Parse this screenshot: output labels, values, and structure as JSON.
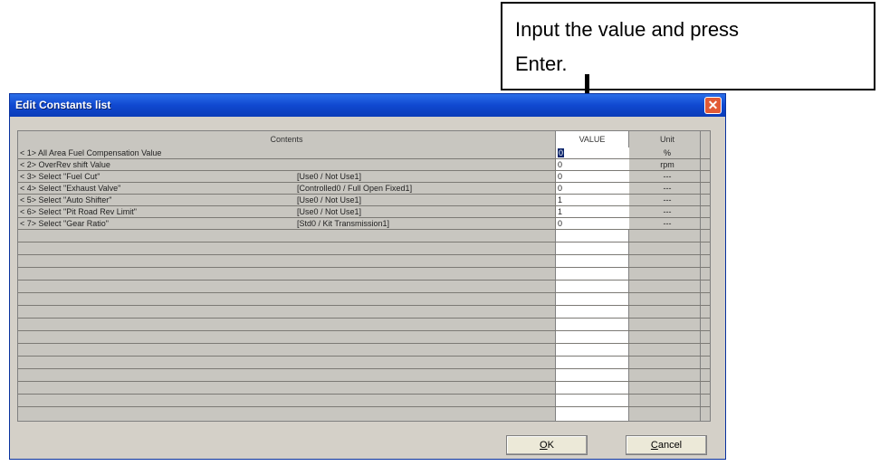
{
  "callout": {
    "text_line1": "Input the value and press",
    "text_line2": "Enter."
  },
  "window": {
    "title": "Edit Constants list",
    "close_glyph": "✕"
  },
  "grid": {
    "headers": {
      "contents": "Contents",
      "value": "VALUE",
      "unit": "Unit"
    },
    "rows": [
      {
        "contents": "< 1> All Area Fuel Compensation Value",
        "option": "",
        "value": "0",
        "unit": "%"
      },
      {
        "contents": "< 2> OverRev shift Value",
        "option": "",
        "value": "0",
        "unit": "rpm"
      },
      {
        "contents": "< 3> Select \"Fuel Cut\"",
        "option": "[Use0 / Not Use1]",
        "value": "0",
        "unit": "---"
      },
      {
        "contents": "< 4> Select \"Exhaust Valve\"",
        "option": "[Controlled0 / Full Open Fixed1]",
        "value": "0",
        "unit": "---"
      },
      {
        "contents": "< 5> Select \"Auto Shifter\"",
        "option": "[Use0 / Not Use1]",
        "value": "1",
        "unit": "---"
      },
      {
        "contents": "< 6> Select \"Pit Road Rev Limit\"",
        "option": "[Use0 / Not Use1]",
        "value": "1",
        "unit": "---"
      },
      {
        "contents": "< 7> Select \"Gear Ratio\"",
        "option": "[Std0 / Kit Transmission1]",
        "value": "0",
        "unit": "---"
      }
    ]
  },
  "buttons": {
    "ok_mnemonic": "O",
    "ok_rest": "K",
    "cancel_mnemonic": "C",
    "cancel_rest": "ancel"
  }
}
